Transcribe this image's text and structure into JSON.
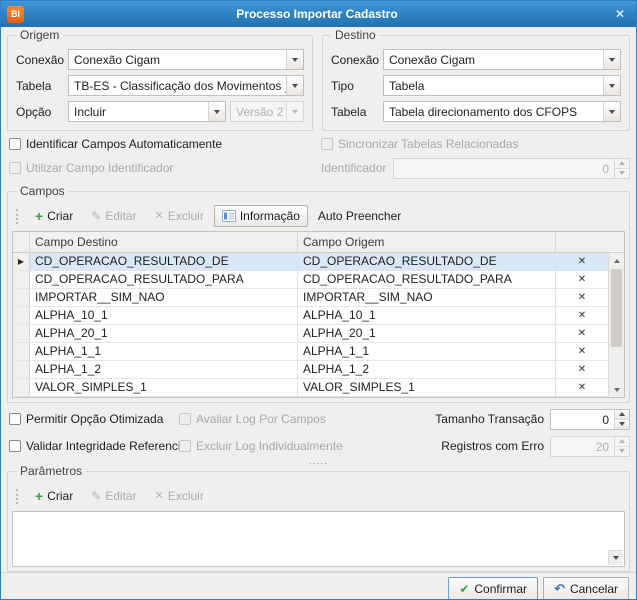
{
  "titlebar": {
    "logo": "BI",
    "title": "Processo Importar Cadastro",
    "close": "✕"
  },
  "origem": {
    "title": "Origem",
    "conexao_label": "Conexão",
    "conexao_value": "Conexão Cigam",
    "tabela_label": "Tabela",
    "tabela_value": "TB-ES - Classificação dos Movimentos _",
    "opcao_label": "Opção",
    "opcao_value": "Incluir",
    "versao_value": "Versão 2"
  },
  "destino": {
    "title": "Destino",
    "conexao_label": "Conexão",
    "conexao_value": "Conexão Cigam",
    "tipo_label": "Tipo",
    "tipo_value": "Tabela",
    "tabela_label": "Tabela",
    "tabela_value": "Tabela direcionamento dos CFOPS"
  },
  "toggles": {
    "identificar": "Identificar Campos Automaticamente",
    "sincronizar": "Sincronizar Tabelas Relacionadas",
    "utilizar": "Utilizar Campo Identificador",
    "identificador_label": "Identificador",
    "identificador_value": "0"
  },
  "campos": {
    "title": "Campos",
    "toolbar": {
      "criar": "Criar",
      "editar": "Editar",
      "excluir": "Excluir",
      "informacao": "Informação",
      "auto_preencher": "Auto Preencher"
    },
    "columns": {
      "destino": "Campo Destino",
      "origem": "Campo Origem"
    },
    "rows": [
      {
        "destino": "CD_OPERACAO_RESULTADO_DE",
        "origem": "CD_OPERACAO_RESULTADO_DE"
      },
      {
        "destino": "CD_OPERACAO_RESULTADO_PARA",
        "origem": "CD_OPERACAO_RESULTADO_PARA"
      },
      {
        "destino": "IMPORTAR__SIM_NAO",
        "origem": "IMPORTAR__SIM_NAO"
      },
      {
        "destino": "ALPHA_10_1",
        "origem": "ALPHA_10_1"
      },
      {
        "destino": "ALPHA_20_1",
        "origem": "ALPHA_20_1"
      },
      {
        "destino": "ALPHA_1_1",
        "origem": "ALPHA_1_1"
      },
      {
        "destino": "ALPHA_1_2",
        "origem": "ALPHA_1_2"
      },
      {
        "destino": "VALOR_SIMPLES_1",
        "origem": "VALOR_SIMPLES_1"
      }
    ]
  },
  "options": {
    "permitir": "Permitir Opção Otimizada",
    "avaliar": "Avaliar Log Por Campos",
    "tamanho_label": "Tamanho Transação",
    "tamanho_value": "0",
    "validar": "Validar Integridade Referencial",
    "excluir_log": "Excluir Log Individualmente",
    "registros_label": "Registros com Erro",
    "registros_value": "20"
  },
  "splitter": {
    "dots": "....."
  },
  "parametros": {
    "title": "Parâmetros",
    "toolbar": {
      "criar": "Criar",
      "editar": "Editar",
      "excluir": "Excluir"
    }
  },
  "footer": {
    "confirmar": "Confirmar",
    "cancelar": "Cancelar"
  },
  "icons": {
    "plus": "+",
    "pencil": "✎",
    "delete_x": "✕",
    "check": "✔",
    "undo": "↶",
    "row_arrow": "▶"
  }
}
